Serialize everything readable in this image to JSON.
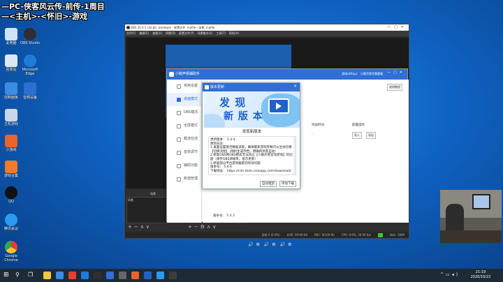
{
  "overlay": {
    "line1": "—PC-侠客风云传-前传-1周目",
    "line2": "—<主机>-<怀旧>-游戏"
  },
  "desktop_icons": [
    {
      "label": "此电脑",
      "color": "#cfe3f7"
    },
    {
      "label": "OBS Studio",
      "color": "#302e31"
    },
    {
      "label": "回收站",
      "color": "#dce8f2"
    },
    {
      "label": "Microsoft Edge",
      "color": "#1f7bd8"
    },
    {
      "label": "控制面板",
      "color": "#3a8de0"
    },
    {
      "label": "音频设备",
      "color": "#2d6fd0"
    },
    {
      "label": "主机游戏",
      "color": "#c9d7e8"
    },
    {
      "label": "小游戏",
      "color": "#e8642a"
    },
    {
      "label": "游戏合集",
      "color": "#f07b2a"
    },
    {
      "label": "QQ",
      "color": "#111111"
    },
    {
      "label": "腾讯会议",
      "color": "#2b9af3"
    },
    {
      "label": "Google Chrome",
      "color": "#e34133"
    }
  ],
  "obs": {
    "title": "OBS 25.0.1 (32-bit, windows) - 配置文件: myfile - 场景: myfile",
    "menu": [
      "文件(F)",
      "编辑(E)",
      "查看(V)",
      "停靠(D)",
      "配置文件(P)",
      "场景集合(S)",
      "工具(T)",
      "帮助(H)"
    ],
    "scenes_header": "场景",
    "scenes_item": "场景",
    "sources_header": "来源",
    "status": {
      "dropped": "丢帧 0 (0.0%)",
      "live": "LIVE: 00:00:00",
      "rec": "REC: 00:00:00",
      "cpu": "CPU: 0.6%, 30.00 fps",
      "kbps": "kb/s: 1849"
    }
  },
  "app": {
    "title": "小鹅声频辅助手",
    "account": "游戏u64ayz",
    "customer_service": "小鹅声频专属客服",
    "nav": [
      {
        "label": "常用设置",
        "active": false
      },
      {
        "label": "桌面模式",
        "active": true
      },
      {
        "label": "OBS模式",
        "active": false
      },
      {
        "label": "全屏模式",
        "active": false
      },
      {
        "label": "截流检测",
        "active": false
      },
      {
        "label": "音效调节",
        "active": false
      },
      {
        "label": "辅助功能",
        "active": false
      },
      {
        "label": "和谐管理",
        "active": false
      }
    ],
    "header_btn": "说明教程",
    "col_add_time": "添加时间",
    "col_config": "配置操作",
    "row_dash": "-",
    "btn_import": "导入",
    "btn_export": "导出",
    "version_footer": "版本号： 5.4.3"
  },
  "dialog": {
    "title": "版本更新",
    "banner_line1": "发 现",
    "banner_line2": "新 版 本",
    "subtitle": "发现新版本",
    "body_lines": [
      "更新版本： 5.4.4",
      "更新日志：",
      "1.桌面设置激活数据读取，确保最新游戏参数可以生效切换",
      "【切换流程】（随机生成存档，明确跨场景自动）",
      "2.修复OBS和OBS模式无法反应【小鹅声频音效游戏】的问题（保存OBS源帧率，提示更新）",
      "3.修复部分平台游戏截取到有效问题",
      "版本号： 5.4.4",
      "下载地址： https://cdn-tools.xiaoapp.com/download/"
    ],
    "btn_update": "自动更新",
    "btn_download": "手动下载"
  },
  "taskbar": {
    "apps": [
      "#f2c744",
      "#3a8de0",
      "#e34133",
      "#1f7bd8",
      "#302e31",
      "#2f6fd6",
      "#666666",
      "#e8642a",
      "#1f63c6",
      "#2b9af3",
      "#3c3c3c"
    ],
    "time": "21:19",
    "date": "2020/10/22"
  }
}
